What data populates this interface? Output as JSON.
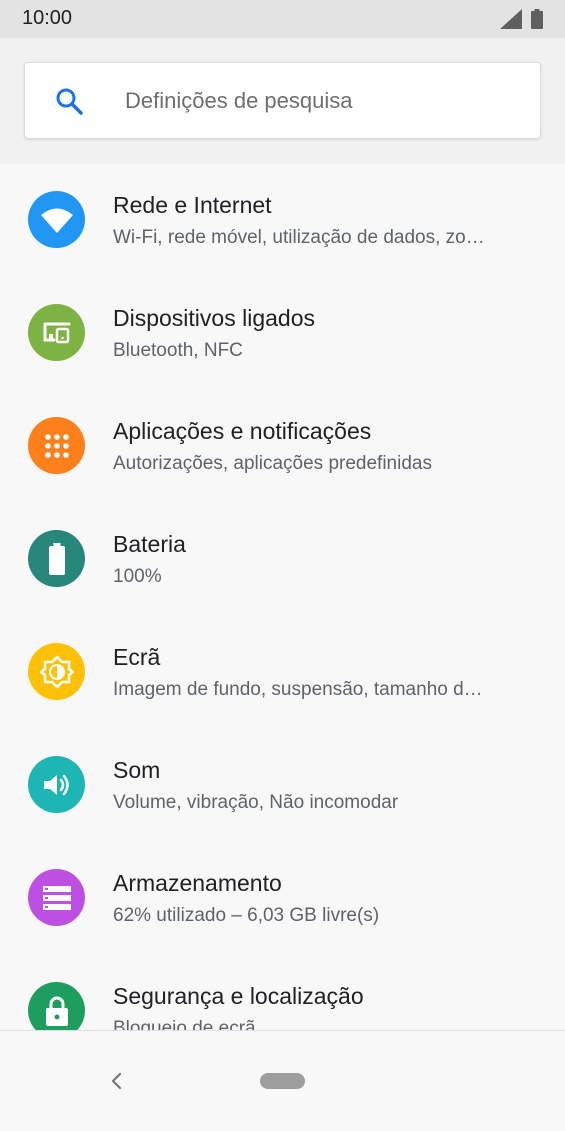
{
  "status_bar": {
    "time": "10:00"
  },
  "search": {
    "placeholder": "Definições de pesquisa"
  },
  "settings": [
    {
      "title": "Rede e Internet",
      "subtitle": "Wi-Fi, rede móvel, utilização de dados, zo…",
      "icon": "wifi-icon",
      "color": "#2196f3"
    },
    {
      "title": "Dispositivos ligados",
      "subtitle": "Bluetooth, NFC",
      "icon": "devices-icon",
      "color": "#7cb342"
    },
    {
      "title": "Aplicações e notificações",
      "subtitle": "Autorizações, aplicações predefinidas",
      "icon": "apps-icon",
      "color": "#ff7f1a"
    },
    {
      "title": "Bateria",
      "subtitle": "100%",
      "icon": "battery-icon",
      "color": "#26877a"
    },
    {
      "title": "Ecrã",
      "subtitle": "Imagem de fundo, suspensão, tamanho d…",
      "icon": "brightness-icon",
      "color": "#ffc107"
    },
    {
      "title": "Som",
      "subtitle": "Volume, vibração, Não incomodar",
      "icon": "volume-icon",
      "color": "#1eb5b5"
    },
    {
      "title": "Armazenamento",
      "subtitle": "62% utilizado – 6,03 GB livre(s)",
      "icon": "storage-icon",
      "color": "#bd4fe3"
    },
    {
      "title": "Segurança e localização",
      "subtitle": "Bloqueio de ecrã",
      "icon": "lock-icon",
      "color": "#1e9e5e"
    }
  ]
}
